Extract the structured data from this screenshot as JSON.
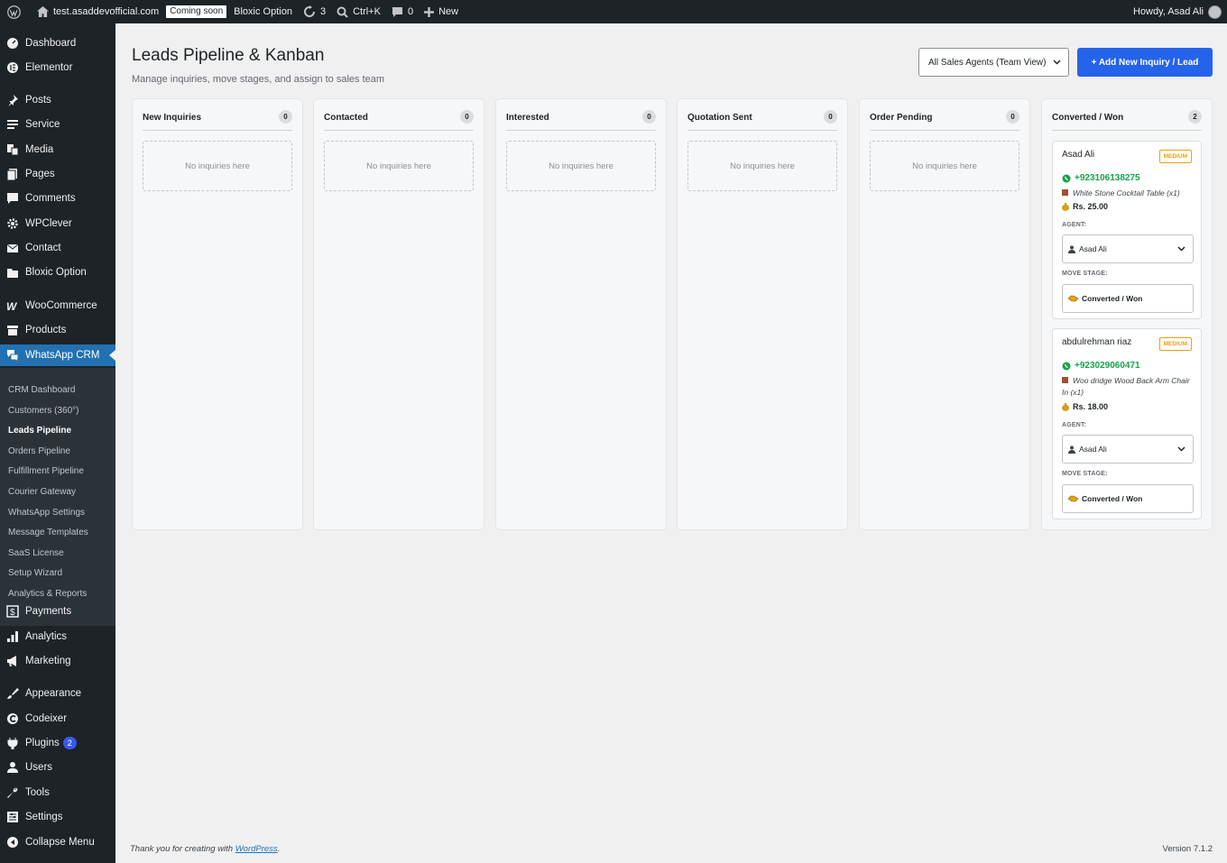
{
  "adminbar": {
    "site": "test.asaddevofficial.com",
    "coming_soon": "Coming soon",
    "bloxic": "Bloxic Option",
    "updates": "3",
    "shortcut": "Ctrl+K",
    "comments": "0",
    "new": "New",
    "howdy": "Howdy, Asad Ali"
  },
  "sidebar": {
    "items": [
      {
        "label": "Dashboard",
        "icon": "dashboard-icon"
      },
      {
        "label": "Elementor",
        "icon": "elementor-icon"
      },
      {
        "label": "Posts",
        "icon": "pin-icon"
      },
      {
        "label": "Service",
        "icon": "list-icon"
      },
      {
        "label": "Media",
        "icon": "media-icon"
      },
      {
        "label": "Pages",
        "icon": "pages-icon"
      },
      {
        "label": "Comments",
        "icon": "comment-icon"
      },
      {
        "label": "WPClever",
        "icon": "gear-icon"
      },
      {
        "label": "Contact",
        "icon": "mail-icon"
      },
      {
        "label": "Bloxic Option",
        "icon": "folder-icon"
      },
      {
        "label": "WooCommerce",
        "icon": "woo-icon"
      },
      {
        "label": "Products",
        "icon": "archive-icon"
      },
      {
        "label": "WhatsApp CRM",
        "icon": "chat-icon"
      },
      {
        "label": "Payments",
        "icon": "dollar-icon"
      },
      {
        "label": "Analytics",
        "icon": "bar-chart-icon"
      },
      {
        "label": "Marketing",
        "icon": "megaphone-icon"
      },
      {
        "label": "Appearance",
        "icon": "brush-icon"
      },
      {
        "label": "Codeixer",
        "icon": "codeixer-icon"
      },
      {
        "label": "Plugins",
        "icon": "plug-icon",
        "badge": "2"
      },
      {
        "label": "Users",
        "icon": "user-icon"
      },
      {
        "label": "Tools",
        "icon": "wrench-icon"
      },
      {
        "label": "Settings",
        "icon": "settings-icon"
      },
      {
        "label": "Collapse Menu",
        "icon": "collapse-icon"
      }
    ],
    "submenu": [
      "CRM Dashboard",
      "Customers (360°)",
      "Leads Pipeline",
      "Orders Pipeline",
      "Fulfillment Pipeline",
      "Courier Gateway",
      "WhatsApp Settings",
      "Message Templates",
      "SaaS License",
      "Setup Wizard",
      "Analytics & Reports"
    ]
  },
  "page": {
    "title": "Leads Pipeline & Kanban",
    "subtitle": "Manage inquiries, move stages, and assign to sales team",
    "agent_filter": "All Sales Agents (Team View)",
    "add_button": "+ Add New Inquiry / Lead"
  },
  "columns": [
    {
      "name": "New Inquiries",
      "count": "0",
      "empty": "No inquiries here"
    },
    {
      "name": "Contacted",
      "count": "0",
      "empty": "No inquiries here"
    },
    {
      "name": "Interested",
      "count": "0",
      "empty": "No inquiries here"
    },
    {
      "name": "Quotation Sent",
      "count": "0",
      "empty": "No inquiries here"
    },
    {
      "name": "Order Pending",
      "count": "0",
      "empty": "No inquiries here"
    },
    {
      "name": "Converted / Won",
      "count": "2"
    }
  ],
  "leads": [
    {
      "name": "Asad Ali",
      "priority": "MEDIUM",
      "phone": "+923106138275",
      "product": "White Stone Cocktail Table (x1)",
      "price": "Rs. 25.00",
      "agent_label": "AGENT:",
      "agent": "Asad Ali",
      "stage_label": "MOVE STAGE:",
      "stage": "Converted / Won"
    },
    {
      "name": "abdulrehman riaz",
      "priority": "MEDIUM",
      "phone": "+923029060471",
      "product": "Woo dridge Wood Back Arm Chair In (x1)",
      "price": "Rs. 18.00",
      "agent_label": "AGENT:",
      "agent": "Asad Ali",
      "stage_label": "MOVE STAGE:",
      "stage": "Converted / Won"
    }
  ],
  "footer": {
    "thanks": "Thank you for creating with ",
    "link": "WordPress",
    "period": ".",
    "version": "Version 7.1.2"
  },
  "colors": {
    "accent": "#2271b1",
    "button": "#2563eb",
    "whatsapp": "#16a34a",
    "priority": "#f59e0b"
  }
}
